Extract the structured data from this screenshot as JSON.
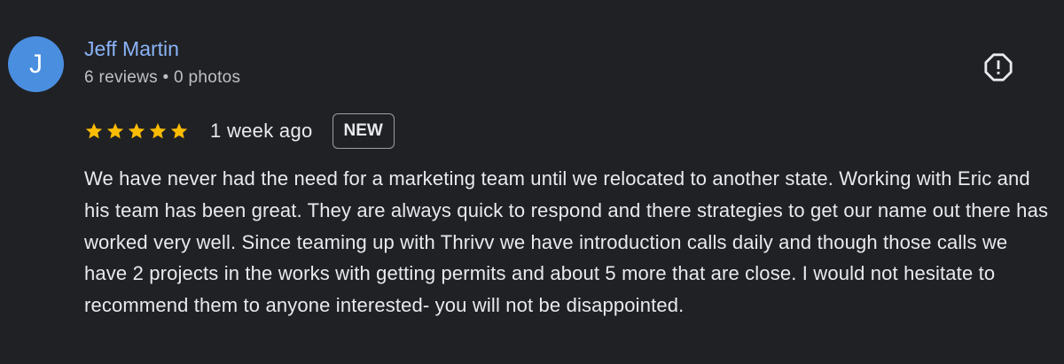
{
  "review": {
    "author": {
      "initial": "J",
      "name": "Jeff Martin",
      "meta": "6 reviews • 0 photos",
      "avatar_color": "#4a8ee0"
    },
    "rating": 5,
    "rating_max": 5,
    "star_color": "#fbbc04",
    "age": "1 week ago",
    "badge": "NEW",
    "flag_icon": "report-flag-icon",
    "text": "We have never had the need for a marketing team until we relocated to another state. Working with Eric and his team has been great. They are always quick to respond and there strategies to get our name out there has worked very well. Since teaming up with Thrivv we have introduction calls daily and though those calls we have 2 projects in the works with getting permits and about 5 more that are close. I would not hesitate to recommend them to anyone interested- you will not be disappointed."
  }
}
